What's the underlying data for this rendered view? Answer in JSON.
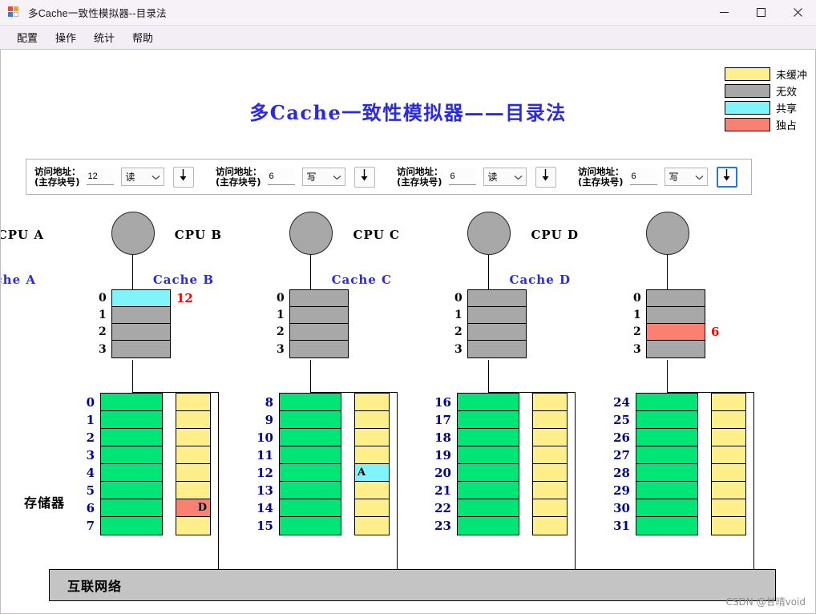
{
  "window": {
    "title": "多Cache一致性模拟器--目录法",
    "icon": "app-icon",
    "controls": [
      {
        "name": "minimize",
        "glyph": "minimize-icon"
      },
      {
        "name": "maximize",
        "glyph": "maximize-icon"
      },
      {
        "name": "close",
        "glyph": "close-icon"
      }
    ]
  },
  "menubar": {
    "items": [
      {
        "label": "配置"
      },
      {
        "label": "操作"
      },
      {
        "label": "统计"
      },
      {
        "label": "帮助"
      }
    ]
  },
  "legend": {
    "items": [
      {
        "label": "未缓冲",
        "color": "#ffef8a"
      },
      {
        "label": "无效",
        "color": "#a8a8a8"
      },
      {
        "label": "共享",
        "color": "#7ff4fb"
      },
      {
        "label": "独占",
        "color": "#fa8072"
      }
    ]
  },
  "page_title": "多Cache一致性模拟器——目录法",
  "controls": {
    "panels": [
      {
        "label_line1": "访问地址：",
        "label_line2": "(主存块号)",
        "address": "12",
        "op": "读",
        "op_options": [
          "读",
          "写"
        ],
        "button_icon": "down-arrow-icon",
        "focused": false
      },
      {
        "label_line1": "访问地址：",
        "label_line2": "(主存块号)",
        "address": "6",
        "op": "写",
        "op_options": [
          "读",
          "写"
        ],
        "button_icon": "down-arrow-icon",
        "focused": false
      },
      {
        "label_line1": "访问地址：",
        "label_line2": "(主存块号)",
        "address": "6",
        "op": "读",
        "op_options": [
          "读",
          "写"
        ],
        "button_icon": "down-arrow-icon",
        "focused": false
      },
      {
        "label_line1": "访问地址：",
        "label_line2": "(主存块号)",
        "address": "6",
        "op": "写",
        "op_options": [
          "读",
          "写"
        ],
        "button_icon": "down-arrow-icon",
        "focused": true
      }
    ]
  },
  "nodes": [
    {
      "cpu_label": "CPU A",
      "cache_label": "Cache A",
      "cache_lines": [
        {
          "index": "0",
          "state": "shared",
          "color": "#7ff4fb",
          "tag": "12"
        },
        {
          "index": "1",
          "state": "invalid",
          "color": "#a8a8a8",
          "tag": ""
        },
        {
          "index": "2",
          "state": "invalid",
          "color": "#a8a8a8",
          "tag": ""
        },
        {
          "index": "3",
          "state": "invalid",
          "color": "#a8a8a8",
          "tag": ""
        }
      ]
    },
    {
      "cpu_label": "CPU B",
      "cache_label": "Cache B",
      "cache_lines": [
        {
          "index": "0",
          "state": "invalid",
          "color": "#a8a8a8",
          "tag": ""
        },
        {
          "index": "1",
          "state": "invalid",
          "color": "#a8a8a8",
          "tag": ""
        },
        {
          "index": "2",
          "state": "invalid",
          "color": "#a8a8a8",
          "tag": ""
        },
        {
          "index": "3",
          "state": "invalid",
          "color": "#a8a8a8",
          "tag": ""
        }
      ]
    },
    {
      "cpu_label": "CPU C",
      "cache_label": "Cache C",
      "cache_lines": [
        {
          "index": "0",
          "state": "invalid",
          "color": "#a8a8a8",
          "tag": ""
        },
        {
          "index": "1",
          "state": "invalid",
          "color": "#a8a8a8",
          "tag": ""
        },
        {
          "index": "2",
          "state": "invalid",
          "color": "#a8a8a8",
          "tag": ""
        },
        {
          "index": "3",
          "state": "invalid",
          "color": "#a8a8a8",
          "tag": ""
        }
      ]
    },
    {
      "cpu_label": "CPU D",
      "cache_label": "Cache D",
      "cache_lines": [
        {
          "index": "0",
          "state": "invalid",
          "color": "#a8a8a8",
          "tag": ""
        },
        {
          "index": "1",
          "state": "invalid",
          "color": "#a8a8a8",
          "tag": ""
        },
        {
          "index": "2",
          "state": "exclusive",
          "color": "#fa8072",
          "tag": "6"
        },
        {
          "index": "3",
          "state": "invalid",
          "color": "#a8a8a8",
          "tag": ""
        }
      ]
    }
  ],
  "memory": {
    "label": "存储器",
    "block_color": "#00e676",
    "banks": [
      {
        "rows": [
          {
            "index": "0",
            "dir_color": "#ffef8a",
            "owner": "",
            "align": "owner-right"
          },
          {
            "index": "1",
            "dir_color": "#ffef8a",
            "owner": "",
            "align": "owner-right"
          },
          {
            "index": "2",
            "dir_color": "#ffef8a",
            "owner": "",
            "align": "owner-right"
          },
          {
            "index": "3",
            "dir_color": "#ffef8a",
            "owner": "",
            "align": "owner-right"
          },
          {
            "index": "4",
            "dir_color": "#ffef8a",
            "owner": "",
            "align": "owner-right"
          },
          {
            "index": "5",
            "dir_color": "#ffef8a",
            "owner": "",
            "align": "owner-right"
          },
          {
            "index": "6",
            "dir_color": "#fa8072",
            "owner": "D",
            "align": "owner-right"
          },
          {
            "index": "7",
            "dir_color": "#ffef8a",
            "owner": "",
            "align": "owner-right"
          }
        ]
      },
      {
        "rows": [
          {
            "index": "8",
            "dir_color": "#ffef8a",
            "owner": "",
            "align": "owner-left"
          },
          {
            "index": "9",
            "dir_color": "#ffef8a",
            "owner": "",
            "align": "owner-left"
          },
          {
            "index": "10",
            "dir_color": "#ffef8a",
            "owner": "",
            "align": "owner-left"
          },
          {
            "index": "11",
            "dir_color": "#ffef8a",
            "owner": "",
            "align": "owner-left"
          },
          {
            "index": "12",
            "dir_color": "#7ff4fb",
            "owner": "A",
            "align": "owner-left"
          },
          {
            "index": "13",
            "dir_color": "#ffef8a",
            "owner": "",
            "align": "owner-left"
          },
          {
            "index": "14",
            "dir_color": "#ffef8a",
            "owner": "",
            "align": "owner-left"
          },
          {
            "index": "15",
            "dir_color": "#ffef8a",
            "owner": "",
            "align": "owner-left"
          }
        ]
      },
      {
        "rows": [
          {
            "index": "16",
            "dir_color": "#ffef8a",
            "owner": "",
            "align": "owner-left"
          },
          {
            "index": "17",
            "dir_color": "#ffef8a",
            "owner": "",
            "align": "owner-left"
          },
          {
            "index": "18",
            "dir_color": "#ffef8a",
            "owner": "",
            "align": "owner-left"
          },
          {
            "index": "19",
            "dir_color": "#ffef8a",
            "owner": "",
            "align": "owner-left"
          },
          {
            "index": "20",
            "dir_color": "#ffef8a",
            "owner": "",
            "align": "owner-left"
          },
          {
            "index": "21",
            "dir_color": "#ffef8a",
            "owner": "",
            "align": "owner-left"
          },
          {
            "index": "22",
            "dir_color": "#ffef8a",
            "owner": "",
            "align": "owner-left"
          },
          {
            "index": "23",
            "dir_color": "#ffef8a",
            "owner": "",
            "align": "owner-left"
          }
        ]
      },
      {
        "rows": [
          {
            "index": "24",
            "dir_color": "#ffef8a",
            "owner": "",
            "align": "owner-left"
          },
          {
            "index": "25",
            "dir_color": "#ffef8a",
            "owner": "",
            "align": "owner-left"
          },
          {
            "index": "26",
            "dir_color": "#ffef8a",
            "owner": "",
            "align": "owner-left"
          },
          {
            "index": "27",
            "dir_color": "#ffef8a",
            "owner": "",
            "align": "owner-left"
          },
          {
            "index": "28",
            "dir_color": "#ffef8a",
            "owner": "",
            "align": "owner-left"
          },
          {
            "index": "29",
            "dir_color": "#ffef8a",
            "owner": "",
            "align": "owner-left"
          },
          {
            "index": "30",
            "dir_color": "#ffef8a",
            "owner": "",
            "align": "owner-left"
          },
          {
            "index": "31",
            "dir_color": "#ffef8a",
            "owner": "",
            "align": "owner-left"
          }
        ]
      }
    ]
  },
  "network": {
    "label": "互联网络"
  },
  "watermark": "CSDN @甘晴void"
}
